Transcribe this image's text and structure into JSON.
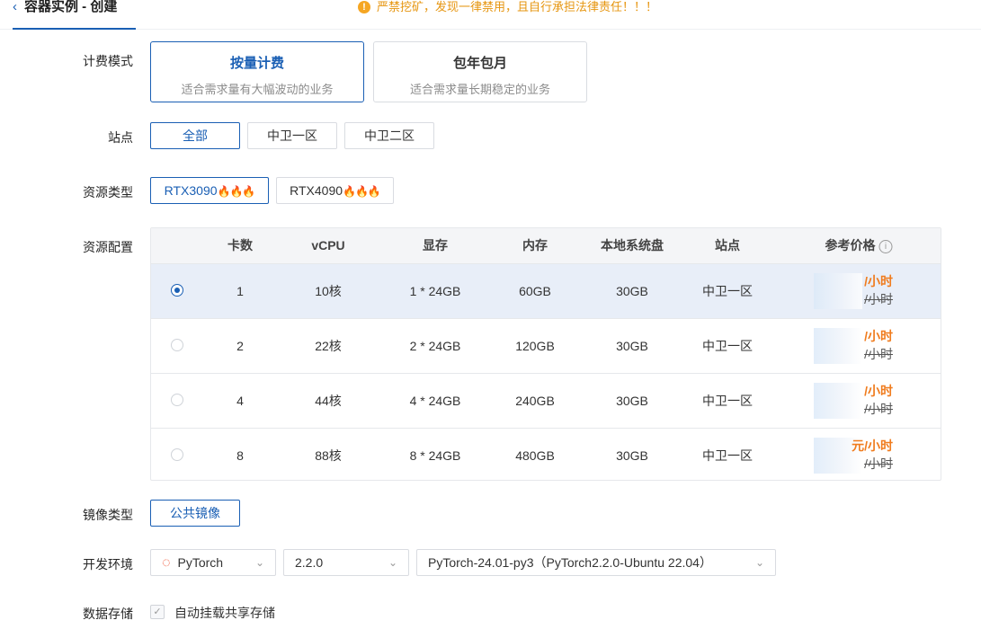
{
  "header": {
    "back_icon": "chevron-left-icon",
    "title": "容器实例 - 创建",
    "warning": "严禁挖矿，发现一律禁用，且自行承担法律责任！！！",
    "warning_icon": "exclamation-circle-icon"
  },
  "colors": {
    "accent": "#1a5fb4",
    "warning": "#f5a623",
    "price": "#f07c1e",
    "selected_row": "#e8eef8"
  },
  "billing": {
    "label": "计费模式",
    "options": [
      {
        "title": "按量计费",
        "desc": "适合需求量有大幅波动的业务",
        "selected": true
      },
      {
        "title": "包年包月",
        "desc": "适合需求量长期稳定的业务",
        "selected": false
      }
    ]
  },
  "site": {
    "label": "站点",
    "options": [
      "全部",
      "中卫一区",
      "中卫二区"
    ],
    "selected": "全部"
  },
  "resource_type": {
    "label": "资源类型",
    "fire_icon": "🔥",
    "options": [
      {
        "name": "RTX3090",
        "selected": true
      },
      {
        "name": "RTX4090",
        "selected": false
      }
    ]
  },
  "resource_config": {
    "label": "资源配置",
    "headers": [
      "卡数",
      "vCPU",
      "显存",
      "内存",
      "本地系统盘",
      "站点",
      "参考价格"
    ],
    "rows": [
      {
        "cards": "1",
        "vcpu": "10核",
        "vram": "1 * 24GB",
        "memory": "60GB",
        "disk": "30GB",
        "site": "中卫一区",
        "price": "/小时",
        "original_price": "/小时",
        "selected": true
      },
      {
        "cards": "2",
        "vcpu": "22核",
        "vram": "2 * 24GB",
        "memory": "120GB",
        "disk": "30GB",
        "site": "中卫一区",
        "price": "/小时",
        "original_price": "/小时",
        "selected": false
      },
      {
        "cards": "4",
        "vcpu": "44核",
        "vram": "4 * 24GB",
        "memory": "240GB",
        "disk": "30GB",
        "site": "中卫一区",
        "price": "/小时",
        "original_price": "/小时",
        "selected": false
      },
      {
        "cards": "8",
        "vcpu": "88核",
        "vram": "8 * 24GB",
        "memory": "480GB",
        "disk": "30GB",
        "site": "中卫一区",
        "price": "元/小时",
        "original_price": "/小时",
        "selected": false
      }
    ]
  },
  "image_type": {
    "label": "镜像类型",
    "option": "公共镜像"
  },
  "dev_env": {
    "label": "开发环境",
    "framework": "PyTorch",
    "framework_icon": "pytorch-flame-icon",
    "version": "2.2.0",
    "image": "PyTorch-24.01-py3（PyTorch2.2.0-Ubuntu 22.04）"
  },
  "storage": {
    "label": "数据存储",
    "checkbox_label": "自动挂载共享存储",
    "checked": true
  }
}
